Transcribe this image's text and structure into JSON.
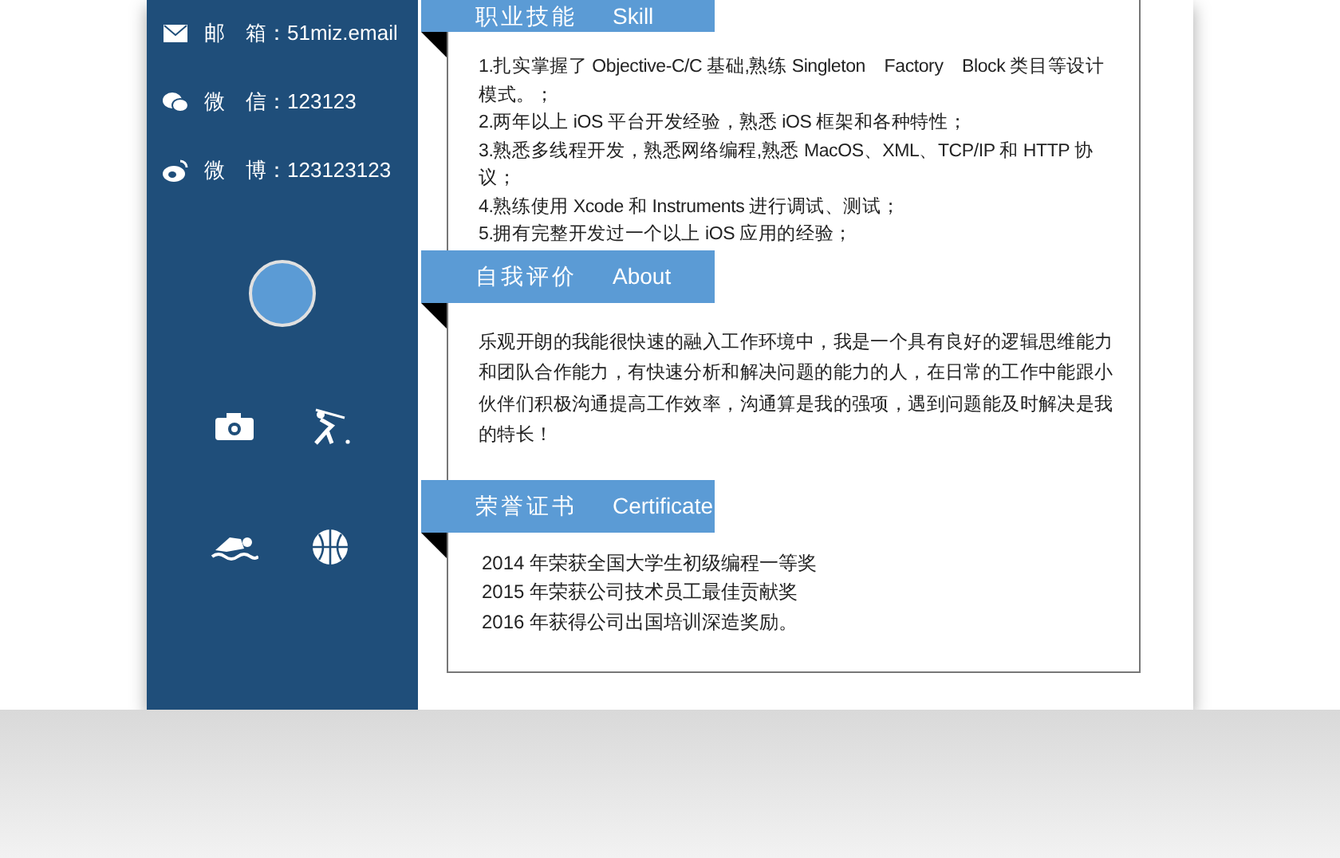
{
  "contacts": [
    {
      "kind": "email",
      "text": "邮　箱：51miz.email"
    },
    {
      "kind": "wechat",
      "text": "微　信：123123"
    },
    {
      "kind": "weibo",
      "text": "微　博：123123123"
    }
  ],
  "hobbies": [
    {
      "kind": "camera"
    },
    {
      "kind": "baseball"
    },
    {
      "kind": "swimming"
    },
    {
      "kind": "basketball"
    }
  ],
  "sections": [
    {
      "title": "职业技能",
      "subtitle": "Skill",
      "kind": "list",
      "lines": [
        "1.扎实掌握了 Objective-C/C 基础,熟练 Singleton　Factory　Block 类目等设计模式。；",
        "2.两年以上 iOS 平台开发经验，熟悉 iOS 框架和各种特性；",
        "3.熟悉多线程开发，熟悉网络编程,熟悉 MacOS、XML、TCP/IP 和 HTTP 协议；",
        "4.熟练使用 Xcode 和 Instruments 进行调试、测试；",
        "5.拥有完整开发过一个以上 iOS 应用的经验；"
      ]
    },
    {
      "title": "自我评价",
      "subtitle": "About",
      "kind": "paragraph",
      "text": "乐观开朗的我能很快速的融入工作环境中，我是一个具有良好的逻辑思维能力和团队合作能力，有快速分析和解决问题的能力的人，在日常的工作中能跟小伙伴们积极沟通提高工作效率，沟通算是我的强项，遇到问题能及时解决是我的特长！"
    },
    {
      "title": "荣誉证书",
      "subtitle": "Certificate",
      "kind": "plain",
      "lines": [
        "2014 年荣获全国大学生初级编程一等奖",
        "2015 年荣获公司技术员工最佳贡献奖",
        "2016 年获得公司出国培训深造奖励。"
      ]
    }
  ]
}
